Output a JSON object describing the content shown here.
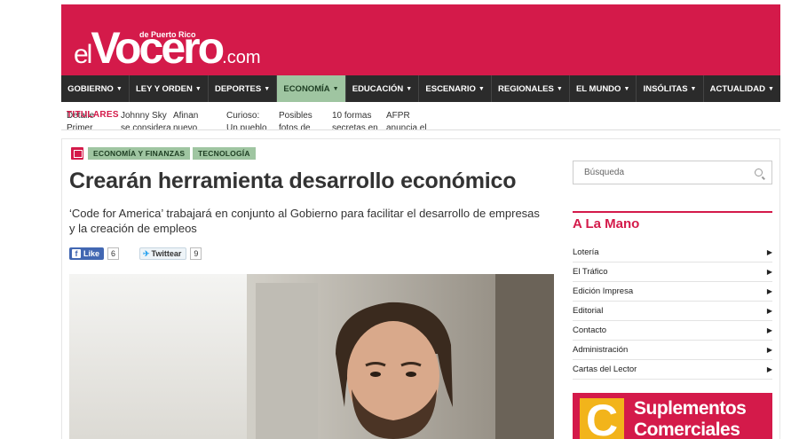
{
  "header": {
    "logo_el": "el",
    "logo_name": "Vocero",
    "logo_tld": ".com",
    "logo_tagline": "de Puerto Rico",
    "brand_color": "#d41a4a"
  },
  "nav": {
    "items": [
      {
        "label": "GOBIERNO"
      },
      {
        "label": "LEY Y ORDEN"
      },
      {
        "label": "DEPORTES"
      },
      {
        "label": "ECONOMÍA"
      },
      {
        "label": "EDUCACIÓN"
      },
      {
        "label": "ESCENARIO"
      },
      {
        "label": "REGIONALES"
      },
      {
        "label": "EL MUNDO"
      },
      {
        "label": "INSÓLITAS"
      },
      {
        "label": "ACTUALIDAD"
      }
    ],
    "active_label": "ECONOMÍA",
    "active_color": "#9fc5a1"
  },
  "ticker": {
    "label": "TITULARES",
    "items": [
      {
        "text": "Detalle Primer"
      },
      {
        "text": "Johnny Sky se considera"
      },
      {
        "text": "Afinan nuevo"
      },
      {
        "text": "Curioso: Un pueblo en"
      },
      {
        "text": "Posibles fotos de"
      },
      {
        "text": "10 formas secretas en"
      },
      {
        "text": "AFPR anuncia el"
      }
    ]
  },
  "article": {
    "categories": [
      "ECONOMÍA Y FINANZAS",
      "TECNOLOGÍA"
    ],
    "category_icon": "newspaper-icon",
    "title": "Crearán herramienta desarrollo económico",
    "subtitle": "‘Code for America’ trabajará en conjunto al Gobierno para facilitar el desarrollo de empresas y la creación de empleos",
    "like_label": "Like",
    "like_count": "6",
    "tweet_label": "Twittear",
    "tweet_count": "9"
  },
  "sidebar": {
    "search_placeholder": "Búsqueda",
    "section_title": "A La Mano",
    "links": [
      {
        "label": "Lotería"
      },
      {
        "label": "El Tráfico"
      },
      {
        "label": "Edición Impresa"
      },
      {
        "label": "Editorial"
      },
      {
        "label": "Contacto"
      },
      {
        "label": "Administración"
      },
      {
        "label": "Cartas del Lector"
      }
    ],
    "ad": {
      "letter": "C",
      "line1": "Suplementos",
      "line2": "Comerciales"
    }
  }
}
